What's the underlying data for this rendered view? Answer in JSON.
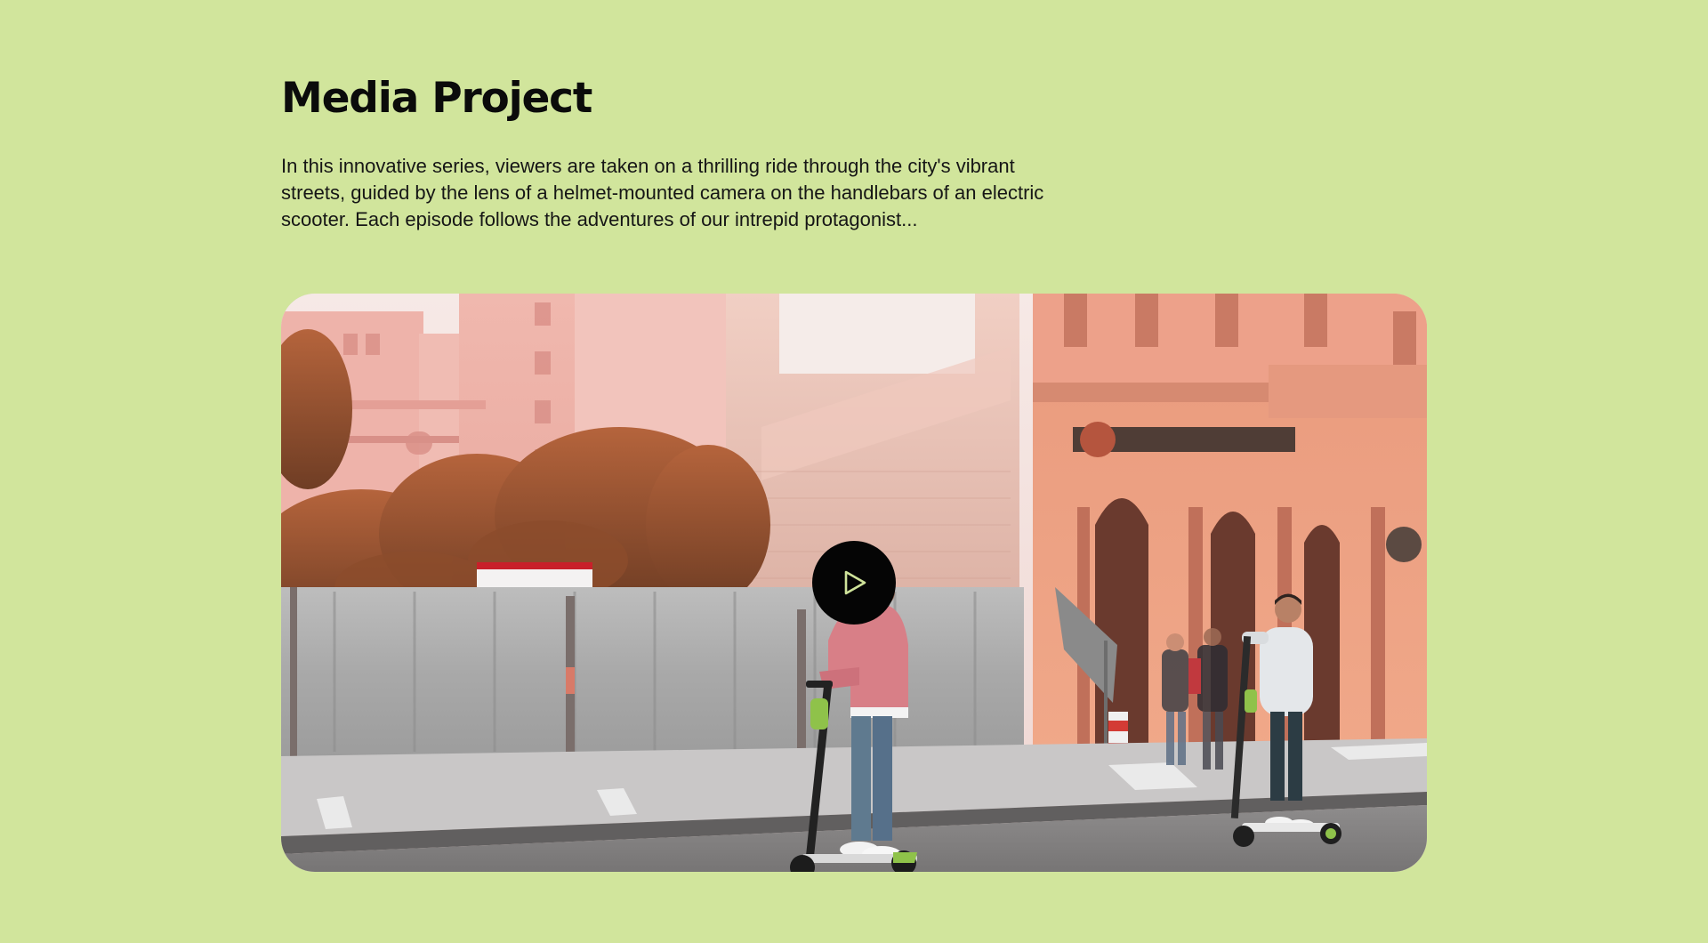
{
  "project": {
    "title": "Media Project",
    "description": "In this innovative series, viewers are taken on a thrilling ride through the city's vibrant streets, guided by the lens of a helmet-mounted camera on the handlebars of an electric scooter. Each episode follows the adventures of our intrepid protagonist..."
  },
  "video": {
    "thumbnail_subject": "two riders on electric scooters on a city street",
    "play_icon": "play-icon"
  },
  "colors": {
    "background": "#d1e59c",
    "text": "#111111",
    "play_button_bg": "#050505",
    "play_icon": "#cfe39a"
  }
}
